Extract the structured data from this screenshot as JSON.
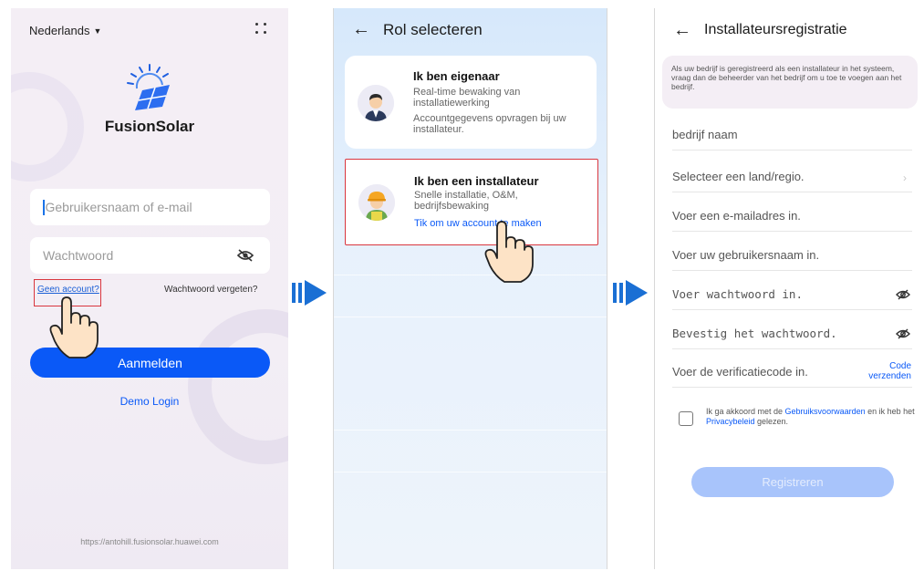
{
  "colors": {
    "primary": "#0a59f7",
    "highlight_border": "#d9363e",
    "arrow": "#1a6fd4"
  },
  "login": {
    "language": "Nederlands",
    "brand": "FusionSolar",
    "username_placeholder": "Gebruikersnaam of e-mail",
    "password_placeholder": "Wachtwoord",
    "no_account": "Geen account?",
    "forgot_password": "Wachtwoord vergeten?",
    "login_button": "Aanmelden",
    "demo_login": "Demo Login",
    "url": "https://antohill.fusionsolar.huawei.com"
  },
  "role": {
    "title": "Rol selecteren",
    "owner": {
      "title": "Ik ben eigenaar",
      "desc1": "Real-time bewaking van installatiewerking",
      "desc2": "Accountgegevens opvragen bij uw installateur."
    },
    "installer": {
      "title": "Ik ben een installateur",
      "desc": "Snelle installatie, O&M, bedrijfsbewaking",
      "link": "Tik om uw account te maken"
    }
  },
  "register": {
    "title": "Installateursregistratie",
    "info": "Als uw bedrijf is geregistreerd als een installateur in het systeem, vraag dan de beheerder van het bedrijf om u toe te voegen aan het bedrijf.",
    "company": "bedrijf naam",
    "country": "Selecteer een land/regio.",
    "email": "Voer een e-mailadres in.",
    "username": "Voer uw gebruikersnaam in.",
    "password": "Voer wachtwoord in.",
    "confirm": "Bevestig het wachtwoord.",
    "code": "Voer de verificatiecode in.",
    "send_code_1": "Code",
    "send_code_2": "verzenden",
    "agree_1": "Ik ga akkoord met de ",
    "agree_terms": "Gebruiksvoorwaarden",
    "agree_2": " en ik heb het ",
    "agree_privacy": "Privacybeleid",
    "agree_3": " gelezen.",
    "register_button": "Registreren"
  }
}
